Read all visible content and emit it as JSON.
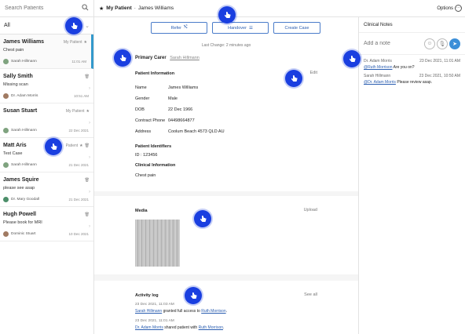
{
  "search": {
    "placeholder": "Search Patients"
  },
  "filter": {
    "value": "All"
  },
  "conversations": [
    {
      "name": "James Williams",
      "tag": "My Patient",
      "message": "Chest pain",
      "who": "Sarah Hillmann",
      "time": "11:01 AM"
    },
    {
      "name": "Sally Smith",
      "tag": "",
      "message": "Missing scan",
      "who": "Dr. Adam Morris",
      "time": "10:51 AM"
    },
    {
      "name": "Susan Stuart",
      "tag": "My Patient",
      "message": "",
      "who": "Sarah Hillmann",
      "time": "22 Dec 2021"
    },
    {
      "name": "Matt Aris",
      "tag": "Patient",
      "message": "Test Case",
      "who": "Sarah Hillmann",
      "time": "21 Dec 2021"
    },
    {
      "name": "James Squire",
      "tag": "",
      "message": "please see asap",
      "who": "Dr. Mary Goodall",
      "time": "21 Dec 2021"
    },
    {
      "name": "Hugh Powell",
      "tag": "",
      "message": "Please book for MRI",
      "who": "Dominic Stuart",
      "time": "10 Dec 2021"
    }
  ],
  "header": {
    "prefix": "My Patient",
    "separator": "·",
    "patient": "James Williams",
    "options": "Options"
  },
  "actions": {
    "refer": "Refer",
    "handover": "Handover",
    "create_case": "Create Case"
  },
  "last_change": "Last Change: 2 minutes ago",
  "primary_carer": {
    "label": "Primary Carer",
    "value": "Sarah Hillmann"
  },
  "patient_info": {
    "title": "Patient Information",
    "edit": "Edit",
    "fields": [
      {
        "k": "Name",
        "v": "James Williams"
      },
      {
        "k": "Gender",
        "v": "Male"
      },
      {
        "k": "DOB",
        "v": "22 Dec 1966"
      },
      {
        "k": "Contract Phone",
        "v": "04498664877"
      },
      {
        "k": "Address",
        "v": "Coolum Beach 4573 QLD AU"
      }
    ]
  },
  "identifiers": {
    "title": "Patient Identifiers",
    "id": "ID : 123456"
  },
  "clinical_info": {
    "title": "Clinical Information",
    "value": "Chest pain"
  },
  "media": {
    "title": "Media",
    "upload": "Upload"
  },
  "activity": {
    "title": "Activity log",
    "see_all": "See all",
    "entries": [
      {
        "time": "23 Dec 2021, 11:03 AM",
        "actor": "Sarah Hillmann",
        "action": "granted full access to",
        "target": "Ruth Morrison",
        "end": "."
      },
      {
        "time": "23 Dec 2021, 11:01 AM",
        "actor": "Dr. Adam Morris",
        "action": "shared patient with",
        "target": "Ruth Morrison",
        "end": "."
      }
    ]
  },
  "clinical_notes": {
    "title": "Clinical Notes",
    "placeholder": "Add a note",
    "notes": [
      {
        "author": "Dr. Adam Morris",
        "time": "23 Dec 2021, 11:01 AM",
        "mention": "@Ruth Morrison",
        "text": "Are you on?"
      },
      {
        "author": "Sarah Hillmann",
        "time": "23 Dec 2021, 10:50 AM",
        "mention": "@Dr. Adam Morris",
        "text": "Please review asap."
      }
    ]
  },
  "colors": {
    "accent": "#2a5db0",
    "hotspot": "#1a3fe0",
    "active_bar": "#3399cc"
  }
}
